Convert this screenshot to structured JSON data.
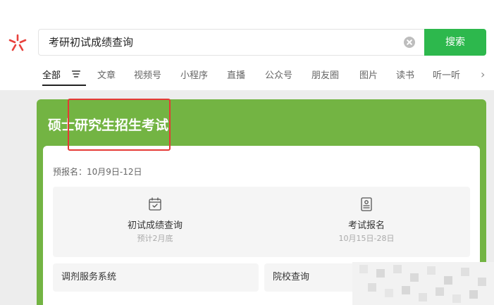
{
  "search": {
    "query": "考研初试成绩查询",
    "button_label": "搜索"
  },
  "tabs": [
    {
      "label": "全部",
      "active": true
    },
    {
      "label": "文章"
    },
    {
      "label": "视频号"
    },
    {
      "label": "小程序"
    },
    {
      "label": "直播"
    },
    {
      "label": "公众号"
    },
    {
      "label": "朋友圈"
    },
    {
      "label": "图片"
    },
    {
      "label": "读书"
    },
    {
      "label": "听一听"
    }
  ],
  "card": {
    "title": "硕士研究生招生考试",
    "pre_registration": "预报名：10月9日-12日",
    "actions": [
      {
        "label": "初试成绩查询",
        "sub": "预计2月底",
        "icon": "calendar-check-icon"
      },
      {
        "label": "考试报名",
        "sub": "10月15日-28日",
        "icon": "document-icon"
      }
    ],
    "links": [
      {
        "label": "调剂服务系统"
      },
      {
        "label": "院校查询"
      }
    ]
  },
  "colors": {
    "accent_green": "#2db84d",
    "card_green": "#73b443",
    "highlight_red": "#e53935",
    "logo_red": "#e8413c"
  }
}
